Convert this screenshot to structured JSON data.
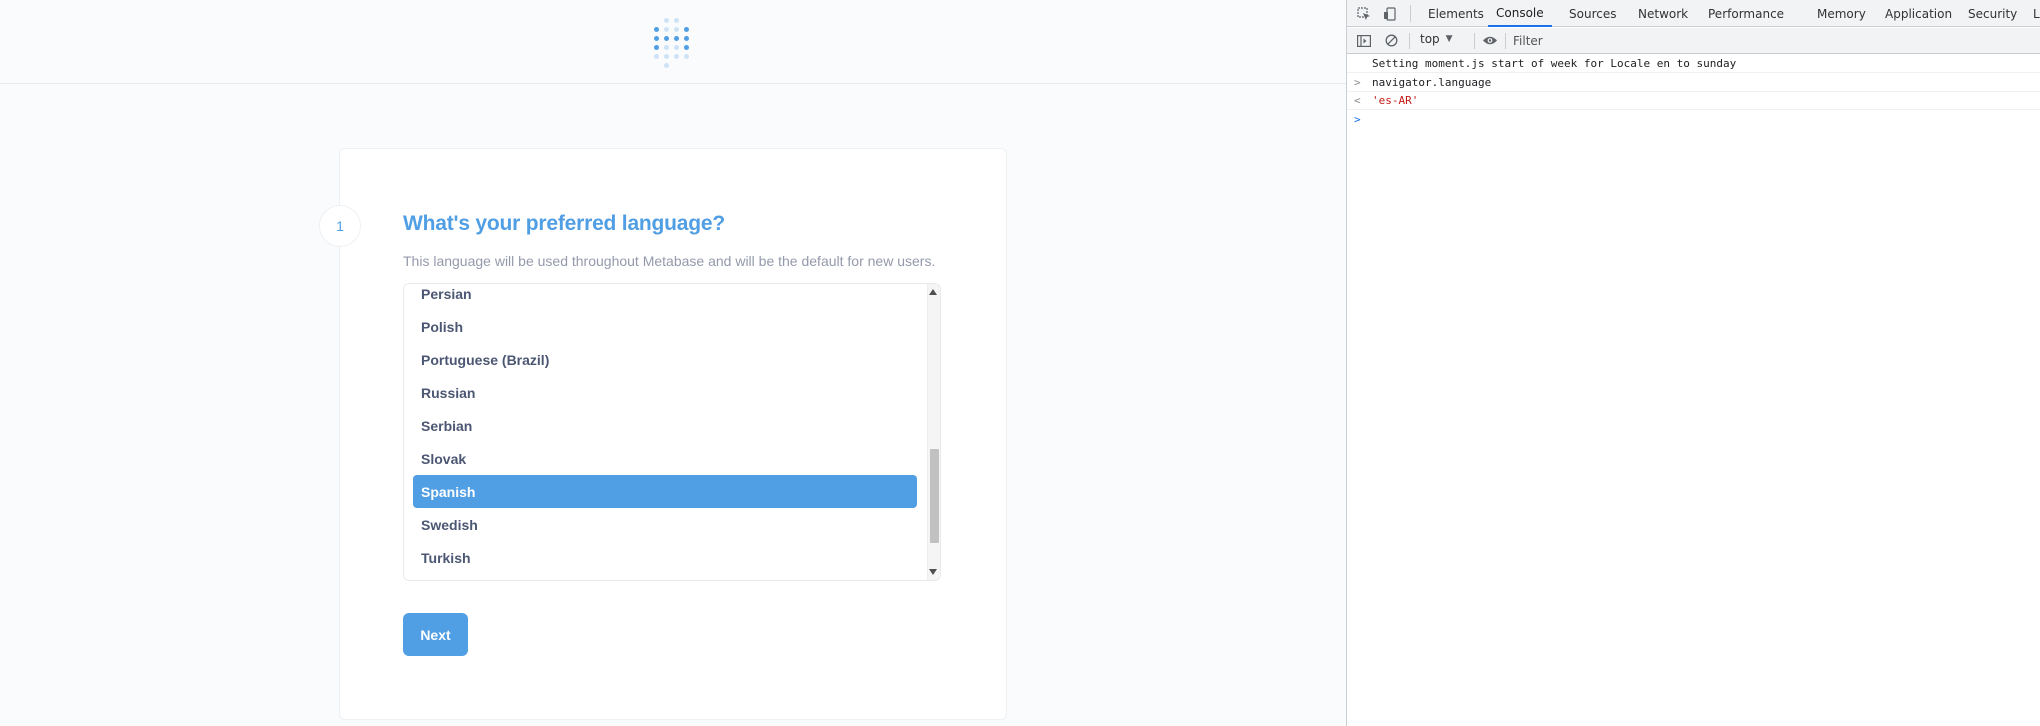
{
  "app": {
    "step_number": "1",
    "title": "What's your preferred language?",
    "description": "This language will be used throughout Metabase and will be the default for new users.",
    "languages": [
      "Persian",
      "Polish",
      "Portuguese (Brazil)",
      "Russian",
      "Serbian",
      "Slovak",
      "Spanish",
      "Swedish",
      "Turkish"
    ],
    "selected_language": "Spanish",
    "next_label": "Next",
    "colors": {
      "brand": "#509ee3",
      "text_dark": "#4c5773",
      "text_light": "#949aab"
    }
  },
  "devtools": {
    "tabs": [
      "Elements",
      "Console",
      "Sources",
      "Network",
      "Performance",
      "Memory",
      "Application",
      "Security",
      "L"
    ],
    "active_tab": "Console",
    "icons": [
      "inspect-element-icon",
      "device-toggle-icon",
      "sidebar-toggle-icon",
      "clear-console-icon",
      "eye-icon"
    ],
    "context": "top",
    "filter_placeholder": "Filter",
    "console": {
      "log_message": "Setting moment.js start of week for Locale en to sunday",
      "input_command": "navigator.language",
      "result": "'es-AR'",
      "input_prefix": ">",
      "result_prefix": "<"
    }
  }
}
